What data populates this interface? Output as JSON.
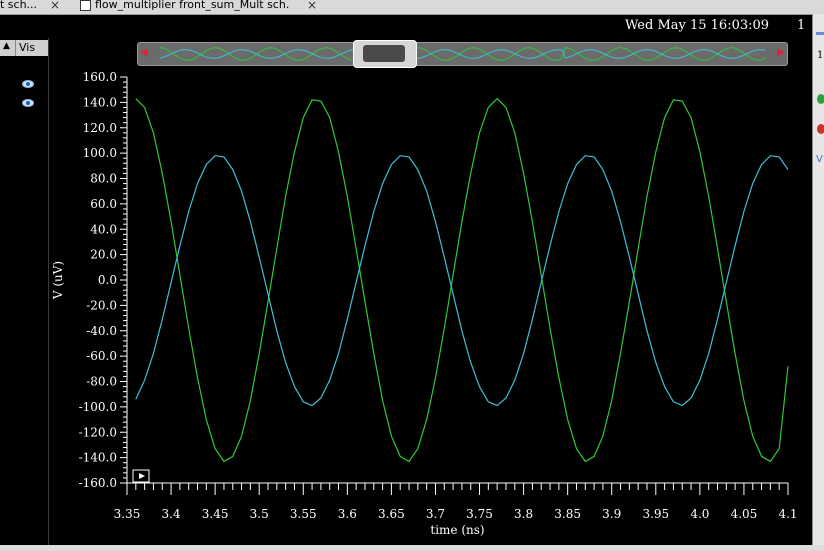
{
  "tabs": [
    {
      "label": "t sch..."
    },
    {
      "label": "flow_multiplier front_sum_Mult sch..."
    }
  ],
  "tab_close_glyph": "×",
  "left_panel": {
    "header_label": "Vis",
    "icons": [
      "eye-icon",
      "eye-icon"
    ]
  },
  "header": {
    "datetime": "Wed May 15 16:03:09",
    "page_number": "1"
  },
  "colors": {
    "background": "#000000",
    "series_1": "#2fc83a",
    "series_2": "#3fc0d8",
    "axis": "#ffffff"
  },
  "chart_data": {
    "type": "line",
    "xlabel": "time (ns)",
    "ylabel": "V (uV)",
    "xlim": [
      3.35,
      4.1
    ],
    "ylim": [
      -160,
      160
    ],
    "x_ticks": [
      3.35,
      3.4,
      3.45,
      3.5,
      3.55,
      3.6,
      3.65,
      3.7,
      3.75,
      3.8,
      3.85,
      3.9,
      3.95,
      4.0,
      4.05,
      4.1
    ],
    "x_tick_labels": [
      "3.35",
      "3.4",
      "3.45",
      "3.5",
      "3.55",
      "3.6",
      "3.65",
      "3.7",
      "3.75",
      "3.8",
      "3.85",
      "3.9",
      "3.95",
      "4.0",
      "4.05",
      "4.1"
    ],
    "y_ticks": [
      160,
      140,
      120,
      100,
      80,
      60,
      40,
      20,
      0,
      -20,
      -40,
      -60,
      -80,
      -100,
      -120,
      -140,
      -160
    ],
    "y_tick_labels": [
      "160.0",
      "140.0",
      "120.0",
      "100.0",
      "80.0",
      "60.0",
      "40.0",
      "20.0",
      "0.0",
      "-20.0",
      "-40.0",
      "-60.0",
      "-80.0",
      "-100.0",
      "-120.0",
      "-140.0",
      "-160.0"
    ],
    "grid": false,
    "series": [
      {
        "x": [
          3.36,
          3.37,
          3.38,
          3.39,
          3.4,
          3.41,
          3.42,
          3.43,
          3.44,
          3.45,
          3.46,
          3.47,
          3.48,
          3.49,
          3.5,
          3.51,
          3.52,
          3.53,
          3.54,
          3.55,
          3.56,
          3.57,
          3.58,
          3.59,
          3.6,
          3.61,
          3.62,
          3.63,
          3.64,
          3.65,
          3.66,
          3.67,
          3.68,
          3.69,
          3.7,
          3.71,
          3.72,
          3.73,
          3.74,
          3.75,
          3.76,
          3.77,
          3.78,
          3.79,
          3.8,
          3.81,
          3.82,
          3.83,
          3.84,
          3.85,
          3.86,
          3.87,
          3.88,
          3.89,
          3.9,
          3.91,
          3.92,
          3.93,
          3.94,
          3.95,
          3.96,
          3.97,
          3.98,
          3.99,
          4.0,
          4.01,
          4.02,
          4.03,
          4.04,
          4.05,
          4.06,
          4.07,
          4.08,
          4.09,
          4.1
        ],
        "y": [
          143,
          136,
          116,
          84,
          46,
          4,
          -38,
          -77,
          -110,
          -133,
          -143,
          -139,
          -123,
          -95,
          -58,
          -17,
          25,
          66,
          101,
          128,
          142,
          141,
          128,
          101,
          66,
          25,
          -17,
          -58,
          -95,
          -123,
          -139,
          -143,
          -133,
          -110,
          -77,
          -38,
          4,
          46,
          84,
          116,
          136,
          143,
          136,
          116,
          84,
          46,
          4,
          -38,
          -77,
          -110,
          -133,
          -143,
          -139,
          -123,
          -95,
          -58,
          -17,
          25,
          66,
          101,
          128,
          142,
          141,
          128,
          101,
          66,
          25,
          -17,
          -58,
          -95,
          -123,
          -139,
          -143,
          -133,
          -68
        ]
      },
      {
        "x": [
          3.36,
          3.37,
          3.38,
          3.39,
          3.4,
          3.41,
          3.42,
          3.43,
          3.44,
          3.45,
          3.46,
          3.47,
          3.48,
          3.49,
          3.5,
          3.51,
          3.52,
          3.53,
          3.54,
          3.55,
          3.56,
          3.57,
          3.58,
          3.59,
          3.6,
          3.61,
          3.62,
          3.63,
          3.64,
          3.65,
          3.66,
          3.67,
          3.68,
          3.69,
          3.7,
          3.71,
          3.72,
          3.73,
          3.74,
          3.75,
          3.76,
          3.77,
          3.78,
          3.79,
          3.8,
          3.81,
          3.82,
          3.83,
          3.84,
          3.85,
          3.86,
          3.87,
          3.88,
          3.89,
          3.9,
          3.91,
          3.92,
          3.93,
          3.94,
          3.95,
          3.96,
          3.97,
          3.98,
          3.99,
          4.0,
          4.01,
          4.02,
          4.03,
          4.04,
          4.05,
          4.06,
          4.07,
          4.08,
          4.09,
          4.1
        ],
        "y": [
          -94,
          -79,
          -58,
          -31,
          -2,
          27,
          54,
          76,
          91,
          98,
          97,
          87,
          70,
          46,
          18,
          -11,
          -40,
          -65,
          -84,
          -96,
          -99,
          -93,
          -79,
          -58,
          -31,
          -2,
          27,
          54,
          76,
          91,
          98,
          97,
          87,
          70,
          46,
          18,
          -11,
          -40,
          -65,
          -84,
          -96,
          -99,
          -93,
          -79,
          -58,
          -31,
          -2,
          27,
          54,
          76,
          91,
          98,
          97,
          87,
          70,
          46,
          18,
          -11,
          -40,
          -65,
          -84,
          -96,
          -99,
          -93,
          -79,
          -58,
          -31,
          -2,
          27,
          54,
          76,
          91,
          98,
          97,
          87
        ]
      }
    ]
  }
}
